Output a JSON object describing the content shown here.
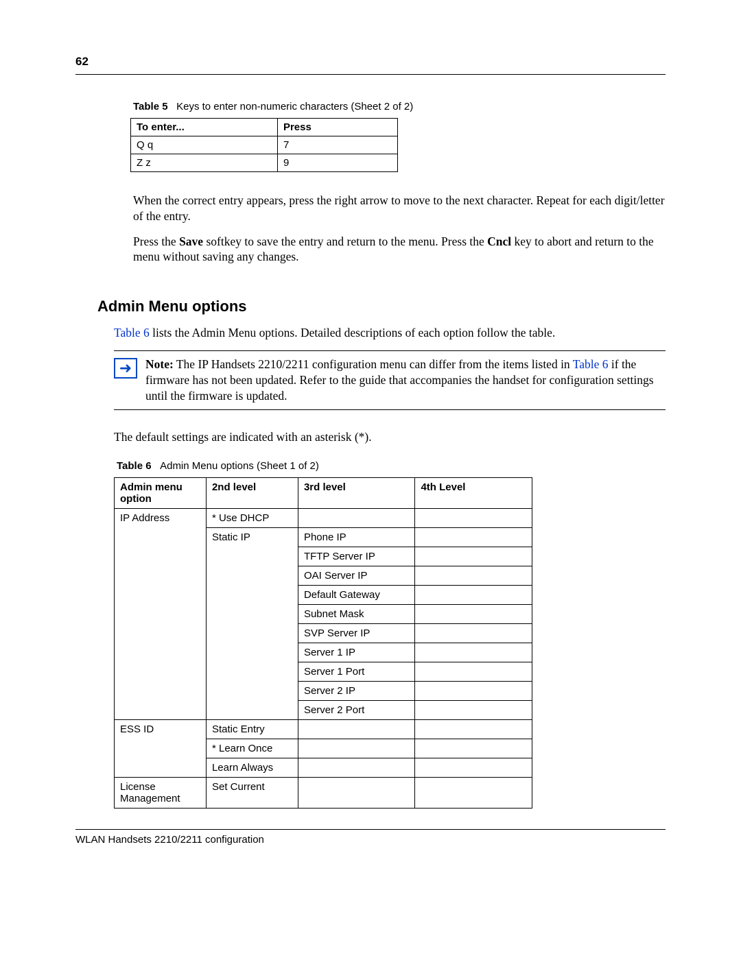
{
  "page_number": "62",
  "table5": {
    "caption_label": "Table 5",
    "caption_text": "Keys to enter non-numeric characters (Sheet 2 of 2)",
    "header": {
      "col1": "To enter...",
      "col2": "Press"
    },
    "rows": [
      {
        "c1": "Q q",
        "c2": "7"
      },
      {
        "c1": "Z z",
        "c2": "9"
      }
    ]
  },
  "para1": "When the correct entry appears, press the right arrow to move to the next character. Repeat for each digit/letter of the entry.",
  "para2_a": "Press the ",
  "para2_save": "Save",
  "para2_b": " softkey to save the entry and return to the menu. Press the ",
  "para2_cncl": "Cncl",
  "para2_c": " key to abort and return to the menu without saving any changes.",
  "heading": "Admin Menu options",
  "para3_link": "Table 6",
  "para3_rest": " lists the Admin Menu options. Detailed descriptions of each option follow the table.",
  "note": {
    "label": "Note:",
    "text_a": " The IP Handsets 2210/2211 configuration menu can differ from the items listed in ",
    "link": "Table 6",
    "text_b": " if the firmware has not been updated. Refer to the guide that accompanies the handset for configuration settings until the firmware is updated."
  },
  "para4": "The default settings are indicated with an asterisk (*).",
  "table6": {
    "caption_label": "Table 6",
    "caption_text": "Admin Menu options (Sheet 1 of 2)",
    "header": {
      "c1": "Admin menu option",
      "c2": "2nd level",
      "c3": "3rd level",
      "c4": "4th Level"
    },
    "ip_label": "IP Address",
    "ip_use_dhcp": "* Use DHCP",
    "ip_static": "Static IP",
    "ip_3rd": [
      "Phone IP",
      "TFTP Server IP",
      "OAI Server IP",
      "Default Gateway",
      "Subnet Mask",
      "SVP Server IP",
      "Server 1 IP",
      "Server 1 Port",
      "Server 2 IP",
      "Server 2 Port"
    ],
    "ess_label": "ESS ID",
    "ess_2nd": [
      "Static Entry",
      "* Learn Once",
      "Learn Always"
    ],
    "lic_label": "License Management",
    "lic_2nd": "Set Current"
  },
  "footer": "WLAN Handsets 2210/2211 configuration"
}
